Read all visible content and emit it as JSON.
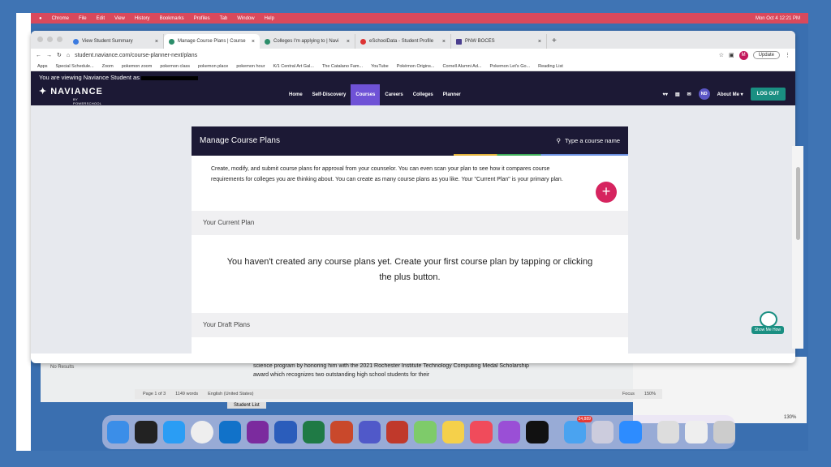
{
  "menubar": {
    "items": [
      "Chrome",
      "File",
      "Edit",
      "View",
      "History",
      "Bookmarks",
      "Profiles",
      "Tab",
      "Window",
      "Help"
    ],
    "clock": "Mon Oct 4  12:21 PM"
  },
  "tabs": [
    {
      "label": "View Student Summary"
    },
    {
      "label": "Manage Course Plans | Course"
    },
    {
      "label": "Colleges I'm applying to | Navi"
    },
    {
      "label": "eSchoolData - Student Profile"
    },
    {
      "label": "PNW BOCES"
    }
  ],
  "address": {
    "url": "student.naviance.com/course-planner-next/plans",
    "update_label": "Update",
    "profile": "M"
  },
  "bookmarks": [
    "Apps",
    "Special Schedule...",
    "Zoom",
    "pokemon zoom",
    "pokemon class",
    "pokemon place",
    "pokemon hour",
    "K/1 Central Art Gal...",
    "The Catalano Fam...",
    "YouTube",
    "Pokémon Origins...",
    "Cornell Alumni Ad...",
    "Pokemon Let's Go...",
    "Reading List"
  ],
  "banner": {
    "text": "You are viewing Naviance Student as"
  },
  "nav": {
    "logo": "NAVIANCE",
    "logo_sub": "BY POWERSCHOOL",
    "items": [
      "Home",
      "Self-Discovery",
      "Courses",
      "Careers",
      "Colleges",
      "Planner"
    ],
    "active": "Courses",
    "initials": "ND",
    "about": "About Me ▾",
    "logout": "LOG OUT"
  },
  "card": {
    "title": "Manage Course Plans",
    "search_label": "Type a course name",
    "intro": "Create, modify, and submit course plans for approval from your counselor. You can even scan your plan to see how it compares course requirements for colleges you are thinking about. You can create as many course plans as you like. Your \"Current Plan\" is your primary plan.",
    "plus": "+",
    "current_heading": "Your Current Plan",
    "empty_message": "You haven't created any course plans yet. Create your first course plan by tapping or clicking the plus button.",
    "draft_heading": "Your Draft Plans"
  },
  "showme": "Show Me How",
  "background": {
    "doc_text": "science program by honoring him with the 2021 Rochester Institute Technology Computing Medal Scholarship award which recognizes two outstanding high school students for their",
    "status": [
      "Page 1 of 3",
      "1149 words",
      "English (United States)",
      "Focus",
      "150%"
    ],
    "sheet_tab": "Student List",
    "no_results": "No Results",
    "zoom2": "130%"
  },
  "dock": {
    "mail_badge": "24,889"
  }
}
